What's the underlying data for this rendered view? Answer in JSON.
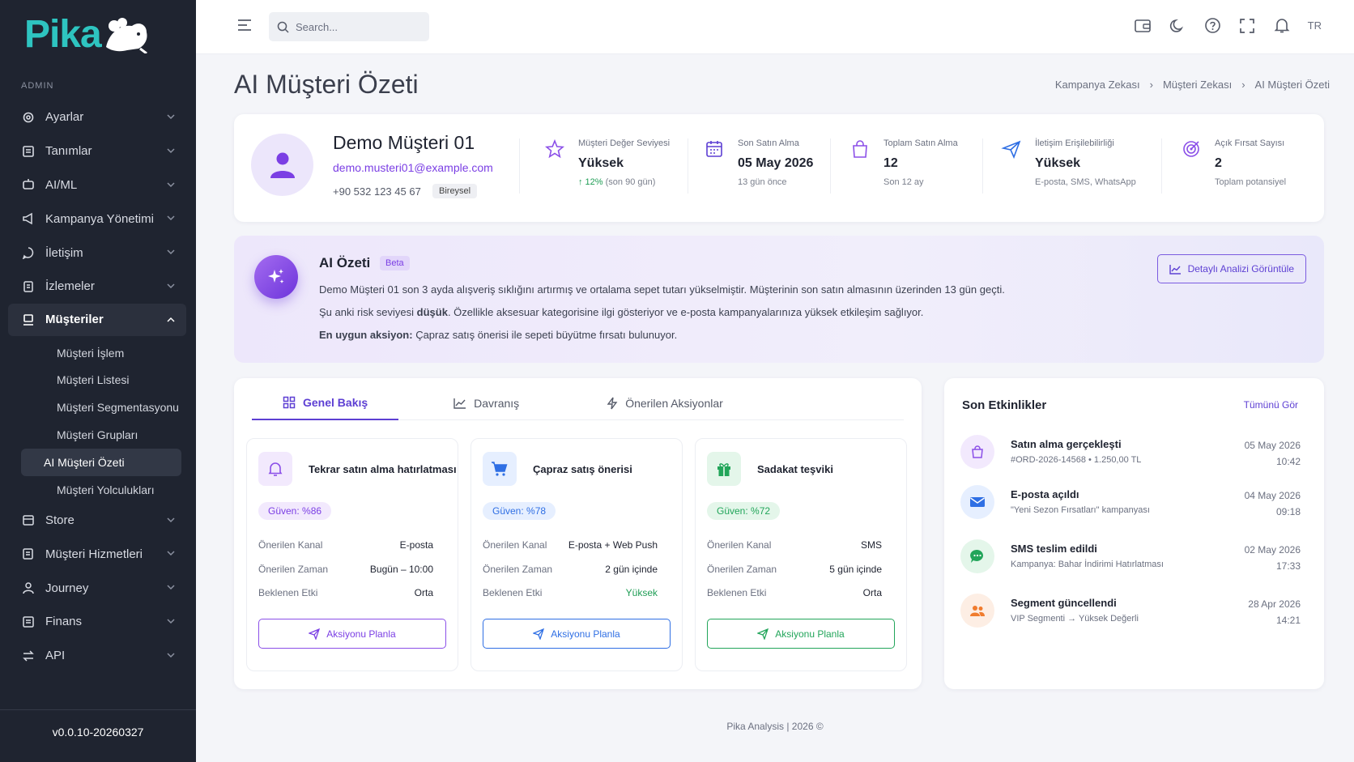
{
  "brand": {
    "name": "Pika",
    "color": "#2ec4c0"
  },
  "sidebar": {
    "section_label": "ADMIN",
    "items": [
      {
        "label": "Ayarlar",
        "icon": "gear-icon"
      },
      {
        "label": "Tanımlar",
        "icon": "list-icon"
      },
      {
        "label": "AI/ML",
        "icon": "robot-icon"
      },
      {
        "label": "Kampanya Yönetimi",
        "icon": "megaphone-icon"
      },
      {
        "label": "İletişim",
        "icon": "chat-icon"
      },
      {
        "label": "İzlemeler",
        "icon": "clipboard-icon"
      },
      {
        "label": "Müşteriler",
        "icon": "customers-icon"
      }
    ],
    "sub_items": [
      "Müşteri İşlem",
      "Müşteri Listesi",
      "Müşteri Segmentasyonu",
      "Müşteri Grupları",
      "AI Müşteri Özeti",
      "Müşteri Yolculukları"
    ],
    "items_after": [
      {
        "label": "Store",
        "icon": "store-icon"
      },
      {
        "label": "Müşteri Hizmetleri",
        "icon": "support-icon"
      },
      {
        "label": "Journey",
        "icon": "user-icon"
      },
      {
        "label": "Finans",
        "icon": "finance-icon"
      },
      {
        "label": "API",
        "icon": "swap-icon"
      }
    ],
    "version": "v0.0.10-20260327"
  },
  "topbar": {
    "search_placeholder": "Search...",
    "lang": "TR"
  },
  "page": {
    "title": "AI Müşteri Özeti",
    "breadcrumb": [
      "Kampanya Zekası",
      "Müşteri Zekası",
      "AI Müşteri Özeti"
    ]
  },
  "profile": {
    "name": "Demo Müşteri 01",
    "email": "demo.musteri01@example.com",
    "phone": "+90 532 123 45 67",
    "badge": "Bireysel",
    "stats": [
      {
        "label": "Müşteri Değer Seviyesi",
        "value": "Yüksek",
        "sub_up": "↑ 12%",
        "sub": " (son 90 gün)"
      },
      {
        "label": "Son Satın Alma",
        "value": "05 May 2026",
        "sub": "13 gün önce"
      },
      {
        "label": "Toplam Satın Alma",
        "value": "12",
        "sub": "Son 12 ay"
      },
      {
        "label": "İletişim Erişilebilirliği",
        "value": "Yüksek",
        "sub": "E-posta, SMS, WhatsApp"
      },
      {
        "label": "Açık Fırsat Sayısı",
        "value": "2",
        "sub": "Toplam potansiyel"
      }
    ]
  },
  "ai_summary": {
    "title": "AI Özeti",
    "badge": "Beta",
    "line1": "Demo Müşteri 01 son 3 ayda alışveriş sıklığını artırmış ve ortalama sepet tutarı yükselmiştir. Müşterinin son satın almasının üzerinden 13 gün geçti.",
    "line2_pre": "Şu anki risk seviyesi ",
    "line2_bold": "düşük",
    "line2_post": ". Özellikle aksesuar kategorisine ilgi gösteriyor ve e-posta kampanyalarınıza yüksek etkileşim sağlıyor.",
    "line3_bold": "En uygun aksiyon:",
    "line3_post": " Çapraz satış önerisi ile sepeti büyütme fırsatı bulunuyor.",
    "button": "Detaylı Analizi Görüntüle"
  },
  "tabs": [
    "Genel Bakış",
    "Davranış",
    "Önerilen Aksiyonlar"
  ],
  "labels": {
    "channel": "Önerilen Kanal",
    "time": "Önerilen Zaman",
    "impact": "Beklenen Etki",
    "plan": "Aksiyonu Planla"
  },
  "actions": [
    {
      "title": "Tekrar satın alma hatırlatması",
      "confidence": "Güven: %86",
      "channel": "E-posta",
      "time": "Bugün – 10:00",
      "impact": "Orta",
      "color": "#8b4fe8"
    },
    {
      "title": "Çapraz satış önerisi",
      "confidence": "Güven: %78",
      "channel": "E-posta + Web Push",
      "time": "2 gün içinde",
      "impact": "Yüksek",
      "color": "#2f6fe4"
    },
    {
      "title": "Sadakat teşviki",
      "confidence": "Güven: %72",
      "channel": "SMS",
      "time": "5 gün içinde",
      "impact": "Orta",
      "color": "#22a55a"
    }
  ],
  "events": {
    "title": "Son Etkinlikler",
    "all": "Tümünü Gör",
    "items": [
      {
        "title": "Satın alma gerçekleşti",
        "sub": "#ORD-2026-14568  •  1.250,00 TL",
        "date": "05 May 2026",
        "time": "10:42"
      },
      {
        "title": "E-posta açıldı",
        "sub": "\"Yeni Sezon Fırsatları\" kampanyası",
        "date": "04 May 2026",
        "time": "09:18"
      },
      {
        "title": "SMS teslim edildi",
        "sub": "Kampanya: Bahar İndirimi Hatırlatması",
        "date": "02 May 2026",
        "time": "17:33"
      },
      {
        "title": "Segment güncellendi",
        "sub": "VIP Segmenti → Yüksek Değerli",
        "date": "28 Apr 2026",
        "time": "14:21"
      }
    ]
  },
  "footer": "Pika Analysis | 2026 ©"
}
